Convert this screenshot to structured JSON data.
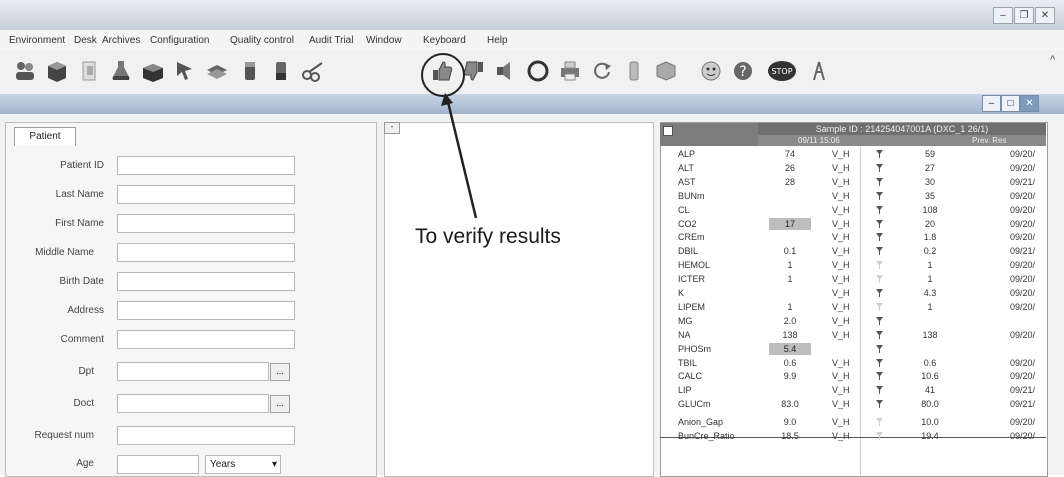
{
  "app": {
    "menus": [
      "Environment",
      "Desk",
      "Archives",
      "Configuration",
      "Quality control",
      "Audit Trial",
      "Window",
      "Keyboard",
      "Help"
    ]
  },
  "toolbar": {
    "icons": [
      "users-icon",
      "box-icon",
      "page-icon",
      "flask-icon",
      "box-open-icon",
      "arrow-icon",
      "layers-icon",
      "tube-icon",
      "tube2-icon",
      "scissors-icon",
      "thumbs-up-icon",
      "thumbs-down-icon",
      "speaker-icon",
      "ring-icon",
      "print-icon",
      "refresh-icon",
      "phone-icon",
      "cube-icon",
      "face-icon",
      "help-icon",
      "stop-icon",
      "exit-icon"
    ],
    "stop_label": "STOP"
  },
  "patient": {
    "tab": "Patient",
    "fields": {
      "patient_id": "Patient ID",
      "last_name": "Last Name",
      "first_name": "First Name",
      "middle_name": "Middle Name",
      "birth_date": "Birth Date",
      "address": "Address",
      "comment": "Comment",
      "dpt": "Dpt",
      "doct": "Doct",
      "request_num": "Request num",
      "age": "Age"
    },
    "age_unit": "Years",
    "lookup_button": "..."
  },
  "results": {
    "sample_title": "Sample ID : 214254047001A (DXC_1 26/1)",
    "current_date": "09/11 15:06",
    "prev_label": "Prev. Res",
    "rows": [
      {
        "name": "ALP",
        "value": "74",
        "flag": "V_H",
        "prev": "59",
        "date": "09/20/"
      },
      {
        "name": "ALT",
        "value": "26",
        "flag": "V_H",
        "prev": "27",
        "date": "09/20/"
      },
      {
        "name": "AST",
        "value": "28",
        "flag": "V_H",
        "prev": "30",
        "date": "09/21/"
      },
      {
        "name": "BUNm",
        "value": "",
        "flag": "V_H",
        "prev": "35",
        "date": "09/20/",
        "bg": "#2b2b2b"
      },
      {
        "name": "CL",
        "value": "",
        "flag": "V_H",
        "prev": "108",
        "date": "09/20/",
        "bg": "#3a3a3a"
      },
      {
        "name": "CO2",
        "value": "17",
        "flag": "V_H",
        "prev": "20",
        "date": "09/20/",
        "bg": "#bdbdbd"
      },
      {
        "name": "CREm",
        "value": "",
        "flag": "V_H",
        "prev": "1.8",
        "date": "09/20/",
        "bg": "#4a4a4a"
      },
      {
        "name": "DBIL",
        "value": "0.1",
        "flag": "V_H",
        "prev": "0.2",
        "date": "09/21/"
      },
      {
        "name": "HEMOL",
        "value": "1",
        "flag": "V_H",
        "prev": "1",
        "date": "09/20/"
      },
      {
        "name": "ICTER",
        "value": "1",
        "flag": "V_H",
        "prev": "1",
        "date": "09/20/"
      },
      {
        "name": "K",
        "value": "",
        "flag": "V_H",
        "prev": "4.3",
        "date": "09/20/",
        "bg": "#2b2b2b"
      },
      {
        "name": "LIPEM",
        "value": "1",
        "flag": "V_H",
        "prev": "1",
        "date": "09/20/"
      },
      {
        "name": "MG",
        "value": "2.0",
        "flag": "V_H",
        "prev": "",
        "date": ""
      },
      {
        "name": "NA",
        "value": "138",
        "flag": "V_H",
        "prev": "138",
        "date": "09/20/"
      },
      {
        "name": "PHOSm",
        "value": "5.4",
        "flag": "",
        "prev": "",
        "date": "",
        "bg": "#bdbdbd"
      },
      {
        "name": "TBIL",
        "value": "0.6",
        "flag": "V_H",
        "prev": "0.6",
        "date": "09/20/"
      },
      {
        "name": "CALC",
        "value": "9.9",
        "flag": "V_H",
        "prev": "10.6",
        "date": "09/20/"
      },
      {
        "name": "LIP",
        "value": "",
        "flag": "V_H",
        "prev": "41",
        "date": "09/21/",
        "bg": "#2b2b2b"
      },
      {
        "name": "GLUCm",
        "value": "83.0",
        "flag": "V_H",
        "prev": "80.0",
        "date": "09/21/"
      },
      {
        "name": "Anion_Gap",
        "value": "9.0",
        "flag": "V_H",
        "prev": "10.0",
        "date": "09/20/"
      },
      {
        "name": "BunCre_Ratio",
        "value": "18.5",
        "flag": "V_H",
        "prev": "19.4",
        "date": "09/20/"
      }
    ]
  },
  "annotation": {
    "text": "To verify results"
  }
}
